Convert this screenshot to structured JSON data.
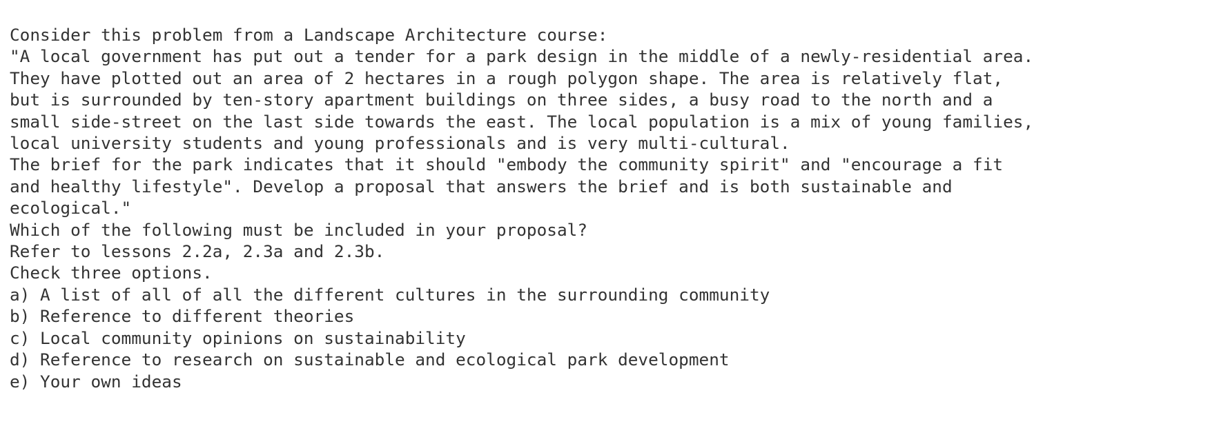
{
  "intro": "Consider this problem from a Landscape Architecture course:",
  "problem_lines": [
    "\"A local government has put out a tender for a park design in the middle of a newly-residential area.",
    "They have plotted out an area of 2 hectares in a rough polygon shape. The area is relatively flat,",
    "but is surrounded by ten-story apartment buildings on three sides, a busy road to the north and a",
    "small side-street on the last side towards the east. The local population is a mix of young families,",
    "local university students and young professionals and is very multi-cultural.",
    "The brief for the park indicates that it should \"embody the community spirit\" and \"encourage a fit",
    "and healthy lifestyle\". Develop a proposal that answers the brief and is both sustainable and",
    "ecological.\""
  ],
  "question": "Which of the following must be included in your proposal?",
  "reference": "Refer to lessons 2.2a, 2.3a and 2.3b.",
  "instruction": "Check three options.",
  "options": [
    "a) A list of all of all the different cultures in the surrounding community",
    "b) Reference to different theories",
    "c) Local community opinions on sustainability",
    "d) Reference to research on sustainable and ecological park development",
    "e) Your own ideas"
  ]
}
